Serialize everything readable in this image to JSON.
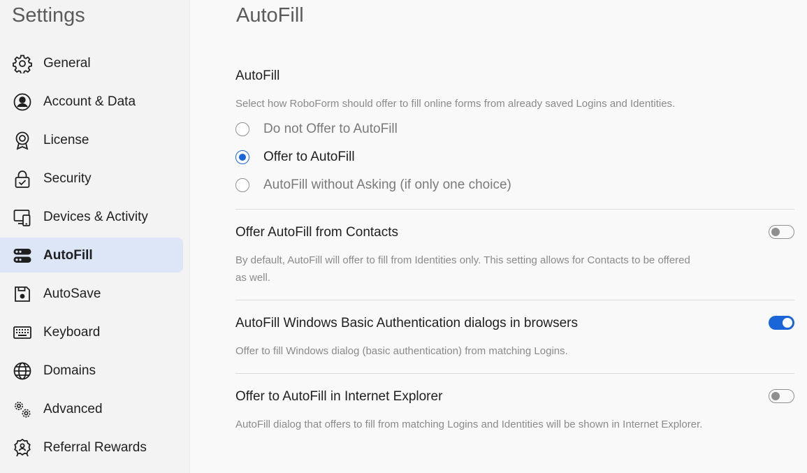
{
  "sidebar": {
    "title": "Settings",
    "items": [
      {
        "label": "General",
        "icon": "gear-icon",
        "active": false
      },
      {
        "label": "Account & Data",
        "icon": "account-icon",
        "active": false
      },
      {
        "label": "License",
        "icon": "license-badge-icon",
        "active": false
      },
      {
        "label": "Security",
        "icon": "lock-icon",
        "active": false
      },
      {
        "label": "Devices & Activity",
        "icon": "devices-icon",
        "active": false
      },
      {
        "label": "AutoFill",
        "icon": "autofill-icon",
        "active": true
      },
      {
        "label": "AutoSave",
        "icon": "save-icon",
        "active": false
      },
      {
        "label": "Keyboard",
        "icon": "keyboard-icon",
        "active": false
      },
      {
        "label": "Domains",
        "icon": "globe-icon",
        "active": false
      },
      {
        "label": "Advanced",
        "icon": "gears-icon",
        "active": false
      },
      {
        "label": "Referral Rewards",
        "icon": "reward-badge-icon",
        "active": false
      }
    ]
  },
  "main": {
    "title": "AutoFill",
    "autofill": {
      "title": "AutoFill",
      "description": "Select how RoboForm should offer to fill online forms from already saved Logins and Identities.",
      "options": [
        {
          "label": "Do not Offer to AutoFill",
          "checked": false
        },
        {
          "label": "Offer to AutoFill",
          "checked": true
        },
        {
          "label": "AutoFill without Asking  (if only one choice)",
          "checked": false
        }
      ]
    },
    "contacts": {
      "title": "Offer AutoFill from Contacts",
      "description_line1": "By default, AutoFill will offer to fill from Identities only. This setting allows for Contacts to be offered",
      "description_line2": "as well.",
      "enabled": false
    },
    "windows_auth": {
      "title": "AutoFill Windows Basic Authentication dialogs in browsers",
      "description": "Offer to fill Windows dialog (basic authentication) from matching Logins.",
      "enabled": true
    },
    "ie": {
      "title": "Offer to AutoFill in Internet Explorer",
      "description": "AutoFill dialog that offers to fill from matching Logins and Identities will be shown in Internet Explorer.",
      "enabled": false
    }
  },
  "colors": {
    "accent": "#1a66d9",
    "active_nav_bg": "#dce6f7",
    "sidebar_bg": "#f3f3f3",
    "main_bg": "#f9f9f9"
  }
}
